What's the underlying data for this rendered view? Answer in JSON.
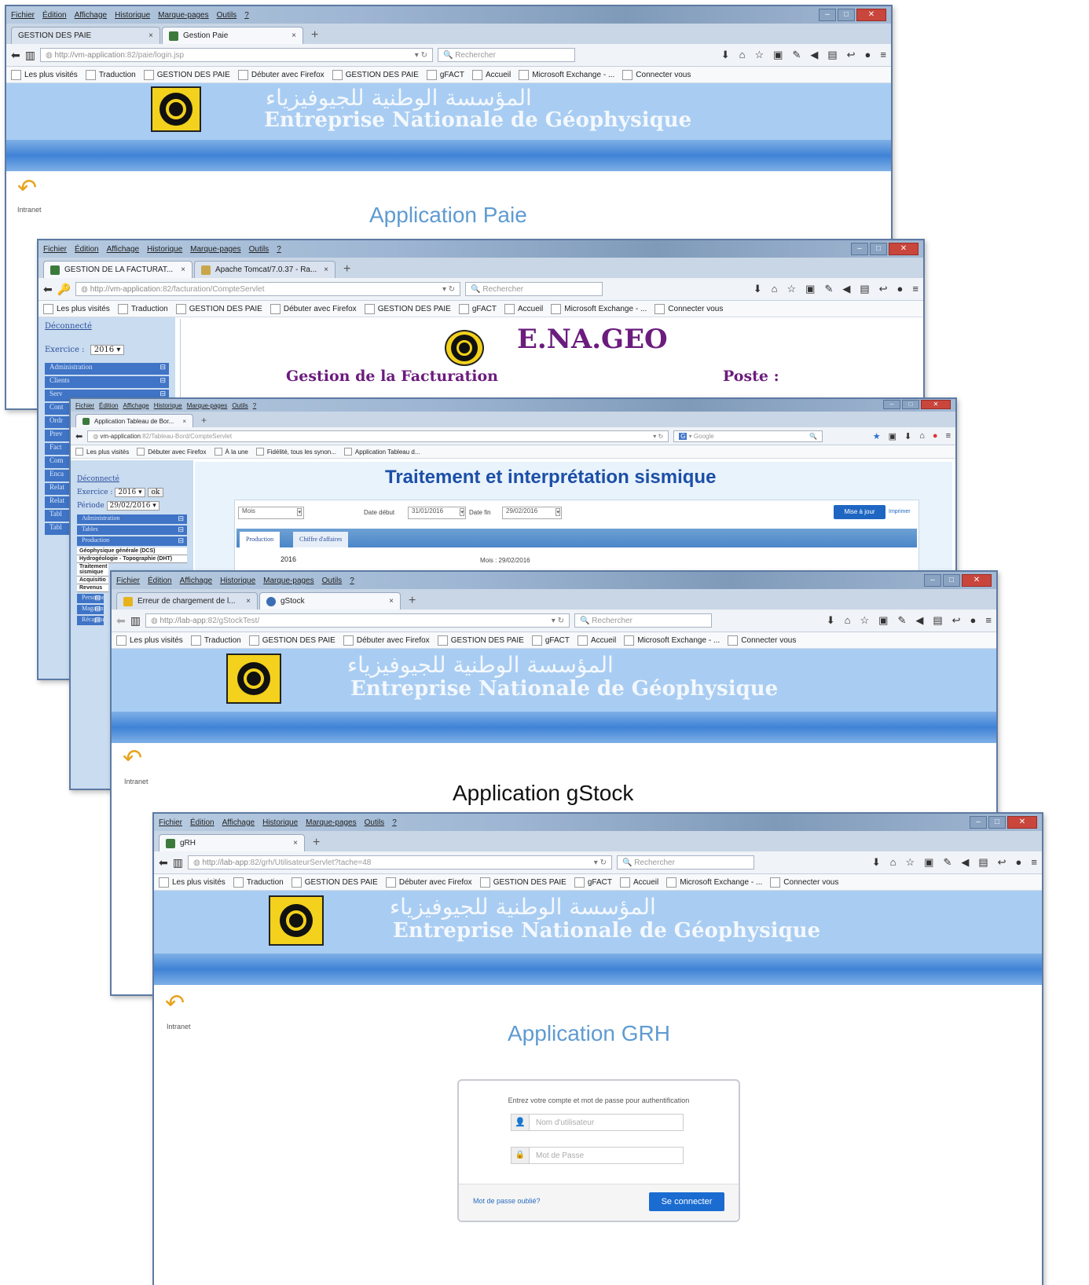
{
  "firefox_menu": [
    "Fichier",
    "Édition",
    "Affichage",
    "Historique",
    "Marque-pages",
    "Outils",
    "?"
  ],
  "bookmarks_common": [
    "Les plus visités",
    "Traduction",
    "GESTION DES PAIE",
    "Débuter avec Firefox",
    "GESTION DES PAIE",
    "gFACT",
    "Accueil",
    "Microsoft Exchange - ...",
    "Connecter vous"
  ],
  "search_placeholder": "Rechercher",
  "banner": {
    "arabic": "المؤسسة الوطنية للجيوفيزياء",
    "french": "Entreprise Nationale de Géophysique"
  },
  "back_label": "Intranet",
  "win_paie": {
    "tabs": [
      "GESTION DES PAIE",
      "Gestion Paie"
    ],
    "url_host": "http://vm-application",
    "url_path": ":82/paie/login.jsp",
    "app_title": "Application Paie"
  },
  "win_fact": {
    "tabs": [
      "GESTION DE LA FACTURAT...",
      "Apache Tomcat/7.0.37 - Ra..."
    ],
    "url_host": "http://vm-application",
    "url_path": ":82/facturation/CompteServlet",
    "logout": "Déconnecté",
    "exercice_label": "Exercice :",
    "exercice_value": "2016",
    "menu": [
      "Administration",
      "Clients"
    ],
    "brand": "E.NA.GEO",
    "subtitle": "Gestion de la Facturation",
    "poste": "Poste :"
  },
  "win_sism": {
    "tab": "Application Tableau de Bor...",
    "url_host": "vm-application",
    "url_path": ":82/Tableau-Bord/CompteServlet",
    "google": "Google",
    "bookmarks": [
      "Les plus visités",
      "Débuter avec Firefox",
      "À la une",
      "Fidélité, tous les synon...",
      "Application Tableau d..."
    ],
    "logout": "Déconnecté",
    "exercice_label": "Exercice :",
    "exercice_value": "2016",
    "periode_label": "Période",
    "periode_value": "29/02/2016",
    "ok": "ok",
    "menu": [
      "Administration",
      "Tables",
      "Production"
    ],
    "sub_items": [
      "Géophysique générale (DCS)",
      "Hydrogéologie - Topographie (DHT)"
    ],
    "title": "Traitement et interprétation sismique",
    "mode": "Mois",
    "date_debut_label": "Date début",
    "date_debut": "31/01/2016",
    "date_fin_label": "Date fin",
    "date_fin": "29/02/2016",
    "update_btn": "Mise à jour",
    "print": "Imprimer",
    "tabs": [
      "Production",
      "Chiffre d'affaires"
    ],
    "year": "2016",
    "month_label": "Mois : 29/02/2016"
  },
  "win_gstock": {
    "tabs": [
      "Erreur de chargement de l...",
      "gStock"
    ],
    "url_host": "http://lab-app",
    "url_path": ":82/gStockTest/",
    "app_title": "Application gStock"
  },
  "win_grh": {
    "tab": "gRH",
    "url_host": "http://lab-app",
    "url_path": ":82/grh/UtilisateurServlet?tache=48",
    "app_title": "Application GRH",
    "login_prompt": "Entrez votre compte et mot de passe pour authentification",
    "username_placeholder": "Nom d'utilisateur",
    "password_placeholder": "Mot de Passe",
    "forgot": "Mot de passe oublié?",
    "connect": "Se connecter"
  },
  "side_stubs": [
    "Serv",
    "Cont",
    "Ordr",
    "Prev",
    "Fact",
    "Com",
    "Enca",
    "Relat",
    "Relat",
    "Tabl",
    "Tabl"
  ],
  "side_stubs2": [
    "Traitement sismique",
    "Acquisitio",
    "Revenus",
    "Personne",
    "Magasin",
    "Récapitu"
  ]
}
